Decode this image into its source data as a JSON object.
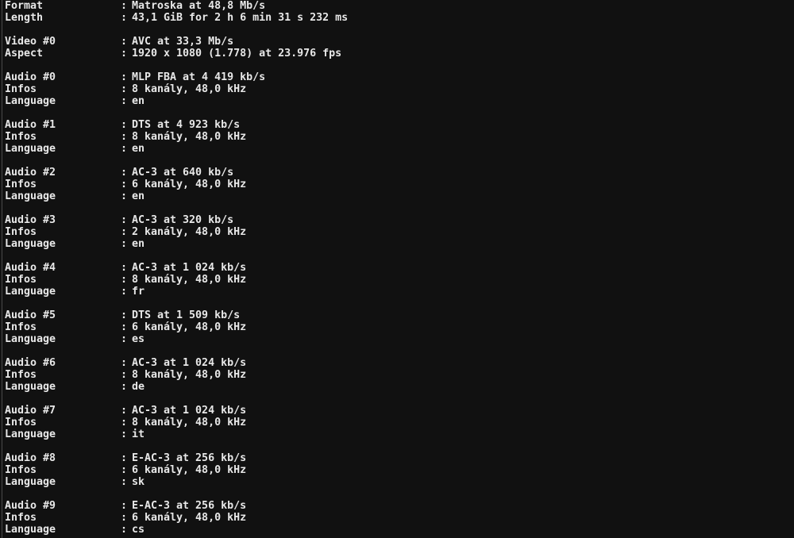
{
  "separator": ":",
  "groups": [
    {
      "rows": [
        {
          "key": "Format",
          "value": "Matroska at 48,8 Mb/s"
        },
        {
          "key": "Length",
          "value": "43,1 GiB for 2 h 6 min 31 s 232 ms"
        }
      ]
    },
    {
      "rows": [
        {
          "key": "Video #0",
          "value": "AVC at 33,3 Mb/s"
        },
        {
          "key": "Aspect",
          "value": "1920 x 1080 (1.778) at 23.976 fps"
        }
      ]
    },
    {
      "rows": [
        {
          "key": "Audio #0",
          "value": "MLP FBA at 4 419 kb/s"
        },
        {
          "key": "Infos",
          "value": "8 kanály, 48,0 kHz"
        },
        {
          "key": "Language",
          "value": "en"
        }
      ]
    },
    {
      "rows": [
        {
          "key": "Audio #1",
          "value": "DTS at 4 923 kb/s"
        },
        {
          "key": "Infos",
          "value": "8 kanály, 48,0 kHz"
        },
        {
          "key": "Language",
          "value": "en"
        }
      ]
    },
    {
      "rows": [
        {
          "key": "Audio #2",
          "value": "AC-3 at 640 kb/s"
        },
        {
          "key": "Infos",
          "value": "6 kanály, 48,0 kHz"
        },
        {
          "key": "Language",
          "value": "en"
        }
      ]
    },
    {
      "rows": [
        {
          "key": "Audio #3",
          "value": "AC-3 at 320 kb/s"
        },
        {
          "key": "Infos",
          "value": "2 kanály, 48,0 kHz"
        },
        {
          "key": "Language",
          "value": "en"
        }
      ]
    },
    {
      "rows": [
        {
          "key": "Audio #4",
          "value": "AC-3 at 1 024 kb/s"
        },
        {
          "key": "Infos",
          "value": "8 kanály, 48,0 kHz"
        },
        {
          "key": "Language",
          "value": "fr"
        }
      ]
    },
    {
      "rows": [
        {
          "key": "Audio #5",
          "value": "DTS at 1 509 kb/s"
        },
        {
          "key": "Infos",
          "value": "6 kanály, 48,0 kHz"
        },
        {
          "key": "Language",
          "value": "es"
        }
      ]
    },
    {
      "rows": [
        {
          "key": "Audio #6",
          "value": "AC-3 at 1 024 kb/s"
        },
        {
          "key": "Infos",
          "value": "8 kanály, 48,0 kHz"
        },
        {
          "key": "Language",
          "value": "de"
        }
      ]
    },
    {
      "rows": [
        {
          "key": "Audio #7",
          "value": "AC-3 at 1 024 kb/s"
        },
        {
          "key": "Infos",
          "value": "8 kanály, 48,0 kHz"
        },
        {
          "key": "Language",
          "value": "it"
        }
      ]
    },
    {
      "rows": [
        {
          "key": "Audio #8",
          "value": "E-AC-3 at 256 kb/s"
        },
        {
          "key": "Infos",
          "value": "6 kanály, 48,0 kHz"
        },
        {
          "key": "Language",
          "value": "sk"
        }
      ]
    },
    {
      "rows": [
        {
          "key": "Audio #9",
          "value": "E-AC-3 at 256 kb/s"
        },
        {
          "key": "Infos",
          "value": "6 kanály, 48,0 kHz"
        },
        {
          "key": "Language",
          "value": "cs"
        }
      ]
    }
  ]
}
